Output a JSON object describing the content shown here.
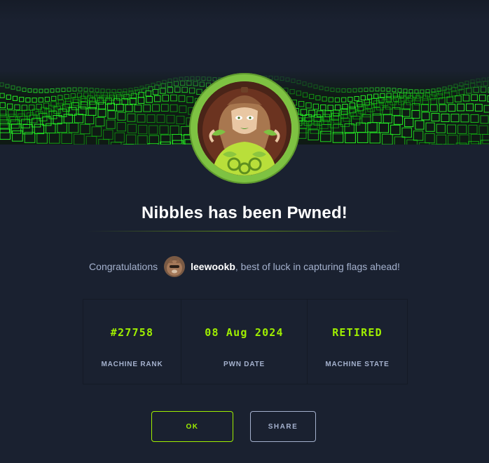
{
  "modal": {
    "title": "Nibbles has been Pwned!",
    "congrats_prefix": "Congratulations",
    "username": "leewookb",
    "congrats_suffix": ", best of luck in capturing flags ahead!"
  },
  "stats": [
    {
      "value": "#27758",
      "label": "MACHINE RANK"
    },
    {
      "value": "08 Aug 2024",
      "label": "PWN DATE"
    },
    {
      "value": "RETIRED",
      "label": "MACHINE STATE"
    }
  ],
  "buttons": {
    "ok_label": "OK",
    "share_label": "SHARE"
  },
  "colors": {
    "background": "#1a2130",
    "accent": "#9fef00",
    "muted_text": "#a4b1cd",
    "avatar_ring": "#7ec242"
  },
  "icons": {
    "banner": "green-cube-wave-banner",
    "machine_avatar": "nibbles-machine-avatar",
    "user_avatar": "user-avatar"
  }
}
